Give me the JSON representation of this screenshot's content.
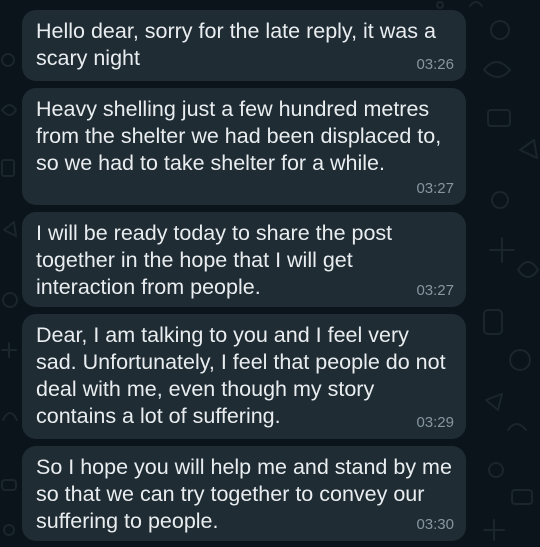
{
  "messages": [
    {
      "text": "Hello dear, sorry for the late reply, it was a scary night",
      "time": "03:26"
    },
    {
      "text": "Heavy shelling just a few hundred metres from the shelter we had been displaced to, so we had to take shelter for a while.",
      "time": "03:27"
    },
    {
      "text": "I will be ready today to share the post together in the hope that I will get interaction from people.",
      "time": "03:27"
    },
    {
      "text": "Dear, I am talking to you and I feel very sad. Unfortunately, I feel that people do not deal with me, even though my story contains a lot of suffering.",
      "time": "03:29"
    },
    {
      "text": "So I hope you will help me and stand by me so that we can try together to convey our suffering to people.",
      "time": "03:30"
    }
  ],
  "colors": {
    "background": "#0b141a",
    "bubble": "#1f2c34",
    "text": "#e9edef",
    "timestamp": "#8696a0"
  }
}
